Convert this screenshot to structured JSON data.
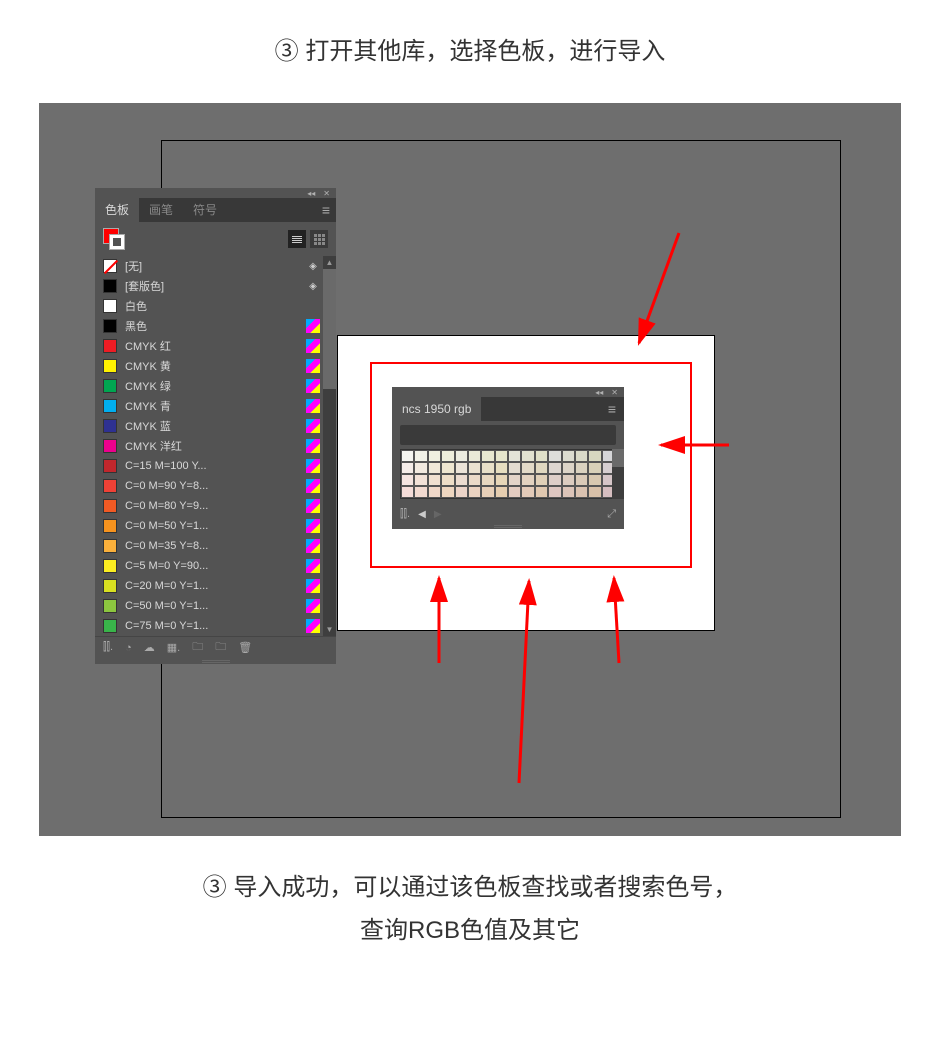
{
  "caption_top": "③ 打开其他库，选择色板，进行导入",
  "caption_bottom_line1": "③ 导入成功，可以通过该色板查找或者搜索色号，",
  "caption_bottom_line2": "查询RGB色值及其它",
  "swatch_panel": {
    "tabs": [
      "色板",
      "画笔",
      "符号"
    ],
    "fill_color": "#ff0000",
    "items": [
      {
        "name": "[无]",
        "color": "#ffffff",
        "special": "none",
        "type": "reg"
      },
      {
        "name": "[套版色]",
        "color": "#000000",
        "type": "reg"
      },
      {
        "name": "白色",
        "color": "#ffffff",
        "type": ""
      },
      {
        "name": "黑色",
        "color": "#000000",
        "type": "process"
      },
      {
        "name": "CMYK 红",
        "color": "#ed1c24",
        "type": "process"
      },
      {
        "name": "CMYK 黄",
        "color": "#fff200",
        "type": "process"
      },
      {
        "name": "CMYK 绿",
        "color": "#00a651",
        "type": "process"
      },
      {
        "name": "CMYK 青",
        "color": "#00aeef",
        "type": "process"
      },
      {
        "name": "CMYK 蓝",
        "color": "#2e3192",
        "type": "process"
      },
      {
        "name": "CMYK 洋红",
        "color": "#ec008c",
        "type": "process"
      },
      {
        "name": "C=15 M=100 Y...",
        "color": "#c1272d",
        "type": "process"
      },
      {
        "name": "C=0 M=90 Y=8...",
        "color": "#ef4136",
        "type": "process"
      },
      {
        "name": "C=0 M=80 Y=9...",
        "color": "#f15a24",
        "type": "process"
      },
      {
        "name": "C=0 M=50 Y=1...",
        "color": "#f7931e",
        "type": "process"
      },
      {
        "name": "C=0 M=35 Y=8...",
        "color": "#fbb03b",
        "type": "process"
      },
      {
        "name": "C=5 M=0 Y=90...",
        "color": "#fcee21",
        "type": "process"
      },
      {
        "name": "C=20 M=0 Y=1...",
        "color": "#d9e021",
        "type": "process"
      },
      {
        "name": "C=50 M=0 Y=1...",
        "color": "#8cc63f",
        "type": "process"
      },
      {
        "name": "C=75 M=0 Y=1...",
        "color": "#39b54a",
        "type": "process"
      }
    ]
  },
  "ncs_panel": {
    "title": "ncs 1950  rgb",
    "search_placeholder": "",
    "grid_rows": 4,
    "grid_cols": 16,
    "cell_colors": [
      "#f5f5f0",
      "#f2f2e8",
      "#f0f0e0",
      "#eeeedc",
      "#ecece0",
      "#eaead8",
      "#e8e8d0",
      "#e6e6cc",
      "#e4e4d8",
      "#e2e2d0",
      "#e0e0c8",
      "#dededa",
      "#dcdcd0",
      "#dadac8",
      "#d8d8c0",
      "#d6d6d8",
      "#f4ece8",
      "#f2eae0",
      "#f0e8d8",
      "#eee6d0",
      "#ece4d8",
      "#eae2d0",
      "#e8e0c8",
      "#e6dec0",
      "#e4dcd0",
      "#e2dac8",
      "#e0d8c0",
      "#ded6d0",
      "#dcd4c8",
      "#dad2c0",
      "#d8d0b8",
      "#d6ced0",
      "#f4e4e0",
      "#f2e2d8",
      "#f0e0d0",
      "#eedec8",
      "#ecdcd0",
      "#eadac8",
      "#e8d8c0",
      "#e6d6b8",
      "#e4d4c8",
      "#e2d2c0",
      "#e0d0b8",
      "#decec8",
      "#dcccc0",
      "#dacab8",
      "#d8c8b0",
      "#d6c6c8",
      "#f4dcd8",
      "#f2dad0",
      "#f0d8c8",
      "#eed6c0",
      "#ecd4c8",
      "#ead2c0",
      "#e8d0b8",
      "#e6ceb0",
      "#e4ccc0",
      "#e2cab8",
      "#e0c8b0",
      "#dec6c0",
      "#dcc4b8",
      "#dac2b0",
      "#d8c0a8",
      "#d6bec0"
    ]
  }
}
